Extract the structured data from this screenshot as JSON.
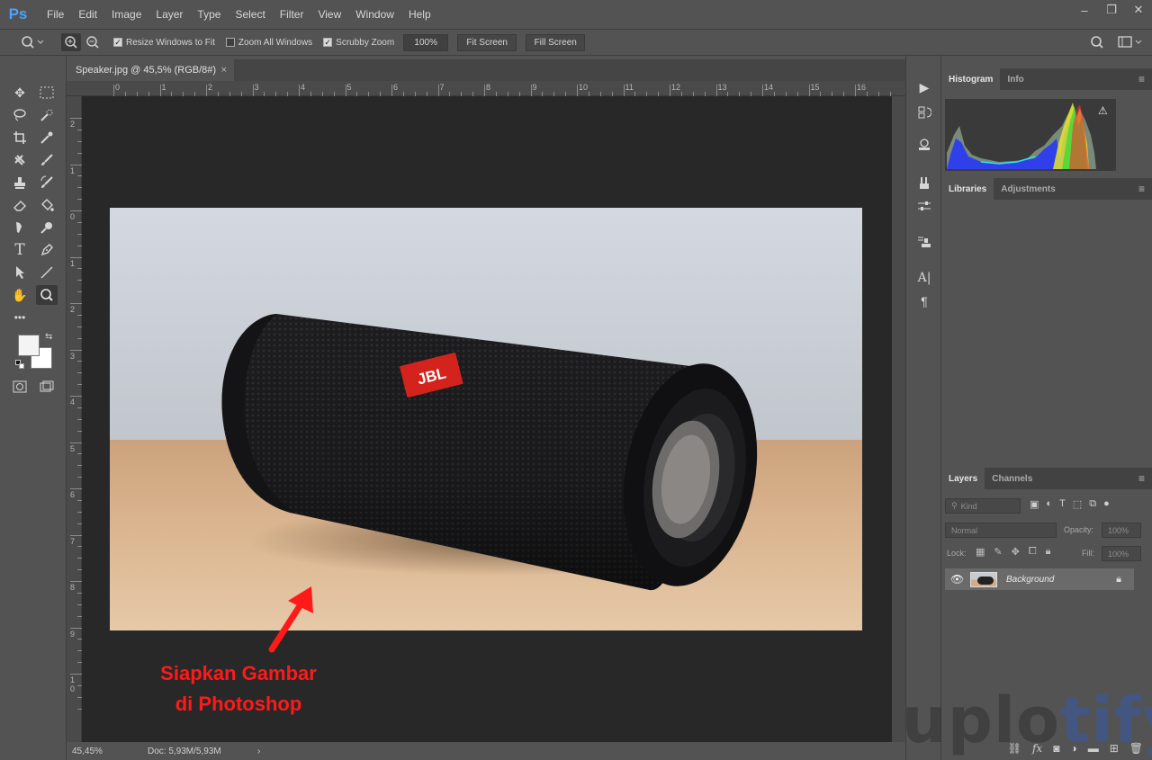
{
  "app": {
    "logo": "Ps"
  },
  "menubar": {
    "items": [
      "File",
      "Edit",
      "Image",
      "Layer",
      "Type",
      "Select",
      "Filter",
      "View",
      "Window",
      "Help"
    ]
  },
  "window_controls": {
    "minimize": "–",
    "restore": "❐",
    "close": "✕"
  },
  "options": {
    "resize_windows": "Resize Windows to Fit",
    "resize_windows_checked": true,
    "zoom_all": "Zoom All Windows",
    "zoom_all_checked": false,
    "scrubby": "Scrubby Zoom",
    "scrubby_checked": true,
    "zoom_value": "100%",
    "fit_screen": "Fit Screen",
    "fill_screen": "Fill Screen"
  },
  "document": {
    "tab_title": "Speaker.jpg @ 45,5% (RGB/8#)",
    "close": "×"
  },
  "rulers": {
    "top": [
      "0",
      "1",
      "2",
      "3",
      "4",
      "5",
      "6",
      "7",
      "8",
      "9",
      "10",
      "11",
      "12",
      "13",
      "14",
      "15",
      "16"
    ],
    "left": [
      "2",
      "1",
      "0",
      "1",
      "2",
      "3",
      "4",
      "5",
      "6",
      "7",
      "8",
      "9",
      "1\n0"
    ]
  },
  "status": {
    "zoom": "45,45%",
    "doc": "Doc: 5,93M/5,93M",
    "arrow": "›"
  },
  "panels": {
    "histogram_tabs": [
      "Histogram",
      "Info"
    ],
    "libraries_tabs": [
      "Libraries",
      "Adjustments"
    ],
    "layers_tabs": [
      "Layers",
      "Channels"
    ],
    "kind": "Kind",
    "blend_mode": "Normal",
    "opacity_label": "Opacity:",
    "opacity_value": "100%",
    "lock_label": "Lock:",
    "fill_label": "Fill:",
    "fill_value": "100%",
    "layer_name": "Background",
    "menu_glyph": "≡"
  },
  "product": {
    "logo_text": "JBL"
  },
  "annotation": {
    "line1": "Siapkan Gambar",
    "line2": "di Photoshop"
  },
  "watermark": {
    "part1": "uplo",
    "part2": "tify"
  },
  "colors": {
    "accent_red": "#ff1a1a",
    "ps_blue": "#4aa3ff"
  }
}
